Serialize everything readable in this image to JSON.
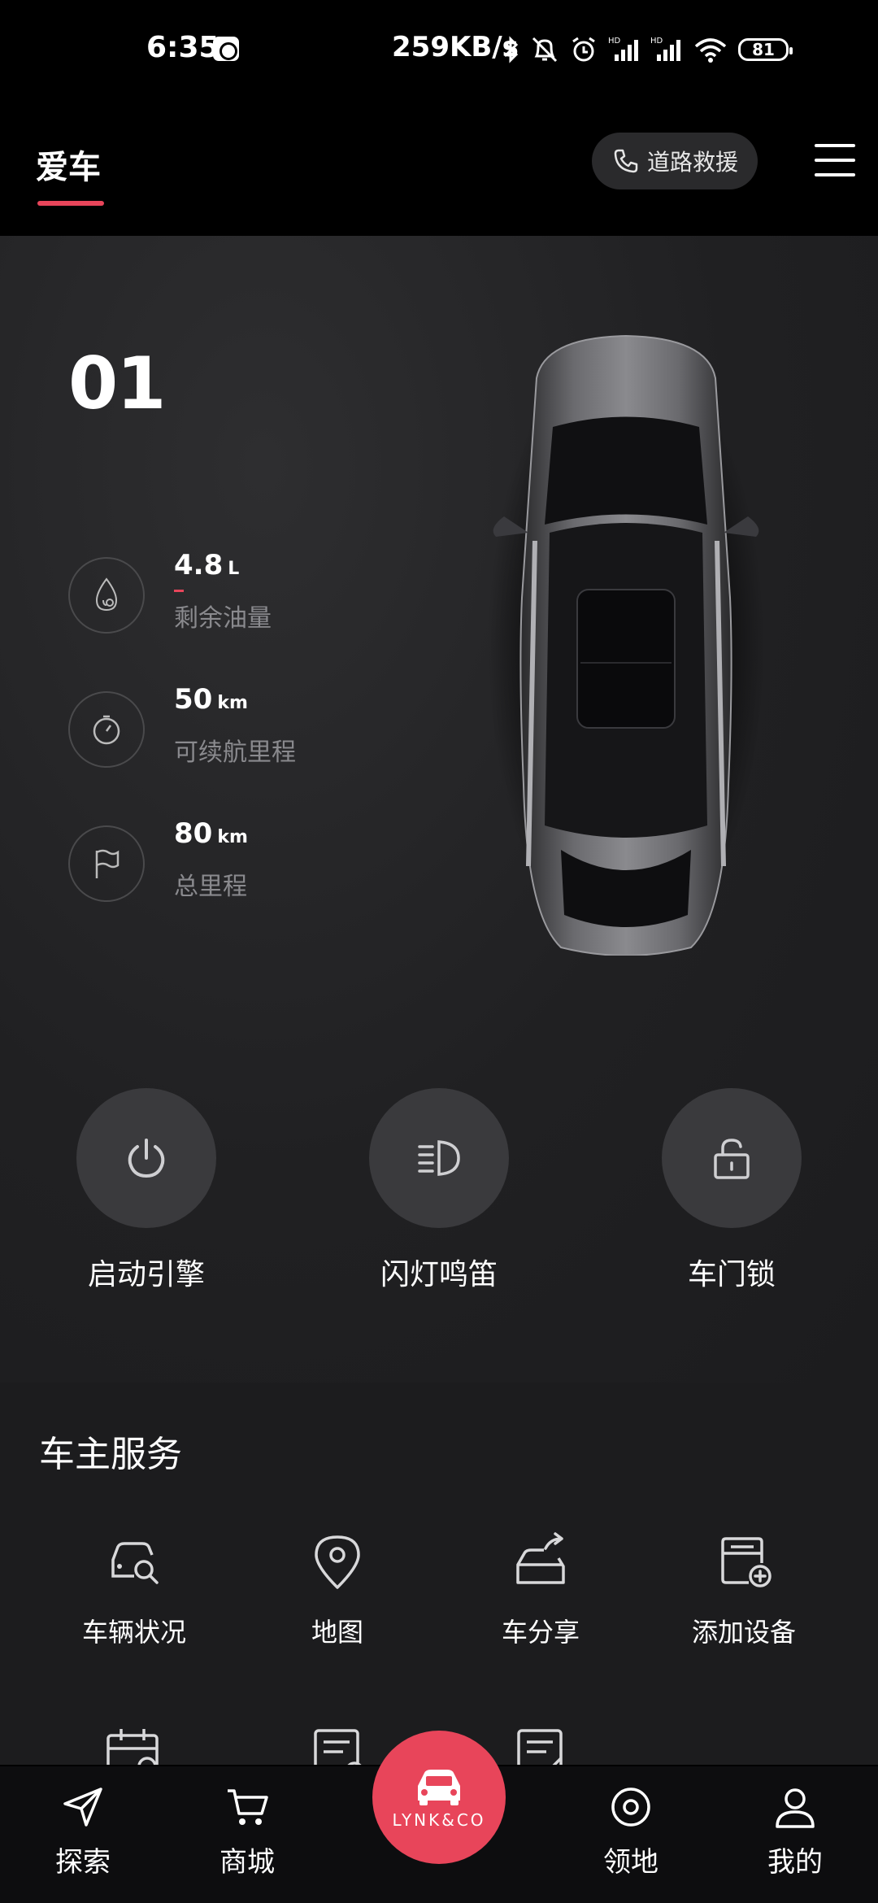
{
  "status_bar": {
    "time": "6:35",
    "network_speed": "259KB/s",
    "battery": "81"
  },
  "header": {
    "title": "爱车",
    "rescue_label": "道路救援"
  },
  "vehicle": {
    "model": "01",
    "stats": [
      {
        "value": "4.8",
        "unit": "L",
        "label": "剩余油量",
        "icon": "fuel-drop-icon"
      },
      {
        "value": "50",
        "unit": "km",
        "label": "可续航里程",
        "icon": "gauge-icon"
      },
      {
        "value": "80",
        "unit": "km",
        "label": "总里程",
        "icon": "flag-icon"
      }
    ]
  },
  "controls": [
    {
      "label": "启动引擎",
      "icon": "power-icon"
    },
    {
      "label": "闪灯鸣笛",
      "icon": "headlight-icon"
    },
    {
      "label": "车门锁",
      "icon": "unlock-icon"
    }
  ],
  "services": {
    "title": "车主服务",
    "items": [
      {
        "label": "车辆状况",
        "icon": "car-search-icon"
      },
      {
        "label": "地图",
        "icon": "map-pin-icon"
      },
      {
        "label": "车分享",
        "icon": "car-share-icon"
      },
      {
        "label": "添加设备",
        "icon": "add-device-icon"
      }
    ]
  },
  "bottom_nav": {
    "items": [
      {
        "label": "探索",
        "icon": "send-icon"
      },
      {
        "label": "商城",
        "icon": "cart-icon"
      },
      {
        "label": "领地",
        "icon": "target-icon"
      },
      {
        "label": "我的",
        "icon": "user-icon"
      }
    ],
    "center_brand": "LYNK&CO"
  },
  "colors": {
    "accent": "#e8455a",
    "background": "#1c1c1e",
    "button": "#3a3a3d"
  }
}
